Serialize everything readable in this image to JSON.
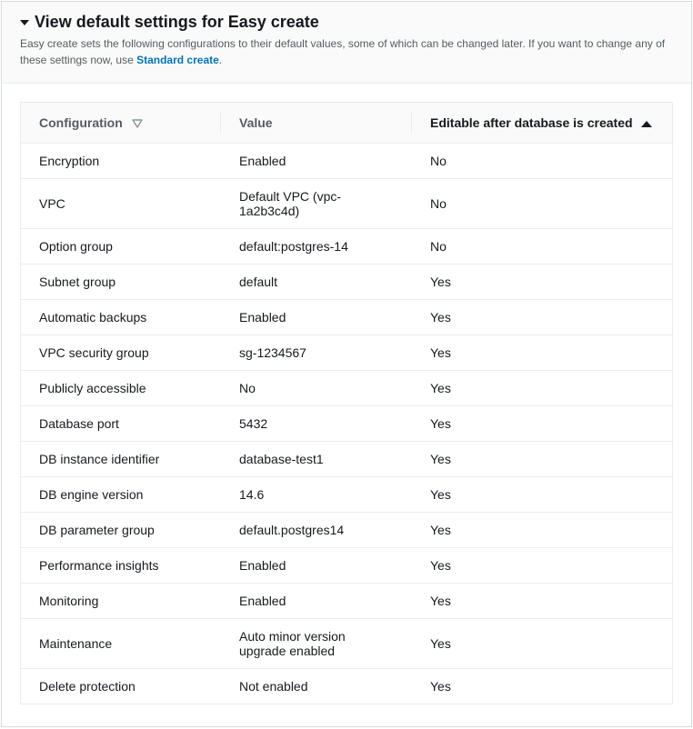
{
  "header": {
    "title": "View default settings for Easy create",
    "description_prefix": "Easy create sets the following configurations to their default values, some of which can be changed later. If you want to change any of these settings now, use ",
    "description_link": "Standard create",
    "description_suffix": "."
  },
  "table": {
    "columns": {
      "config": "Configuration",
      "value": "Value",
      "editable": "Editable after database is created"
    },
    "rows": [
      {
        "config": "Encryption",
        "value": "Enabled",
        "editable": "No"
      },
      {
        "config": "VPC",
        "value": "Default VPC (vpc-1a2b3c4d)",
        "editable": "No"
      },
      {
        "config": "Option group",
        "value": "default:postgres-14",
        "editable": "No"
      },
      {
        "config": "Subnet group",
        "value": "default",
        "editable": "Yes"
      },
      {
        "config": "Automatic backups",
        "value": "Enabled",
        "editable": "Yes"
      },
      {
        "config": "VPC security group",
        "value": "sg-1234567",
        "editable": "Yes"
      },
      {
        "config": "Publicly accessible",
        "value": "No",
        "editable": "Yes"
      },
      {
        "config": "Database port",
        "value": "5432",
        "editable": "Yes"
      },
      {
        "config": "DB instance identifier",
        "value": "database-test1",
        "editable": "Yes"
      },
      {
        "config": "DB engine version",
        "value": "14.6",
        "editable": "Yes"
      },
      {
        "config": "DB parameter group",
        "value": "default.postgres14",
        "editable": "Yes"
      },
      {
        "config": "Performance insights",
        "value": "Enabled",
        "editable": "Yes"
      },
      {
        "config": "Monitoring",
        "value": "Enabled",
        "editable": "Yes"
      },
      {
        "config": "Maintenance",
        "value": "Auto minor version upgrade enabled",
        "editable": "Yes"
      },
      {
        "config": "Delete protection",
        "value": "Not enabled",
        "editable": "Yes"
      }
    ]
  }
}
